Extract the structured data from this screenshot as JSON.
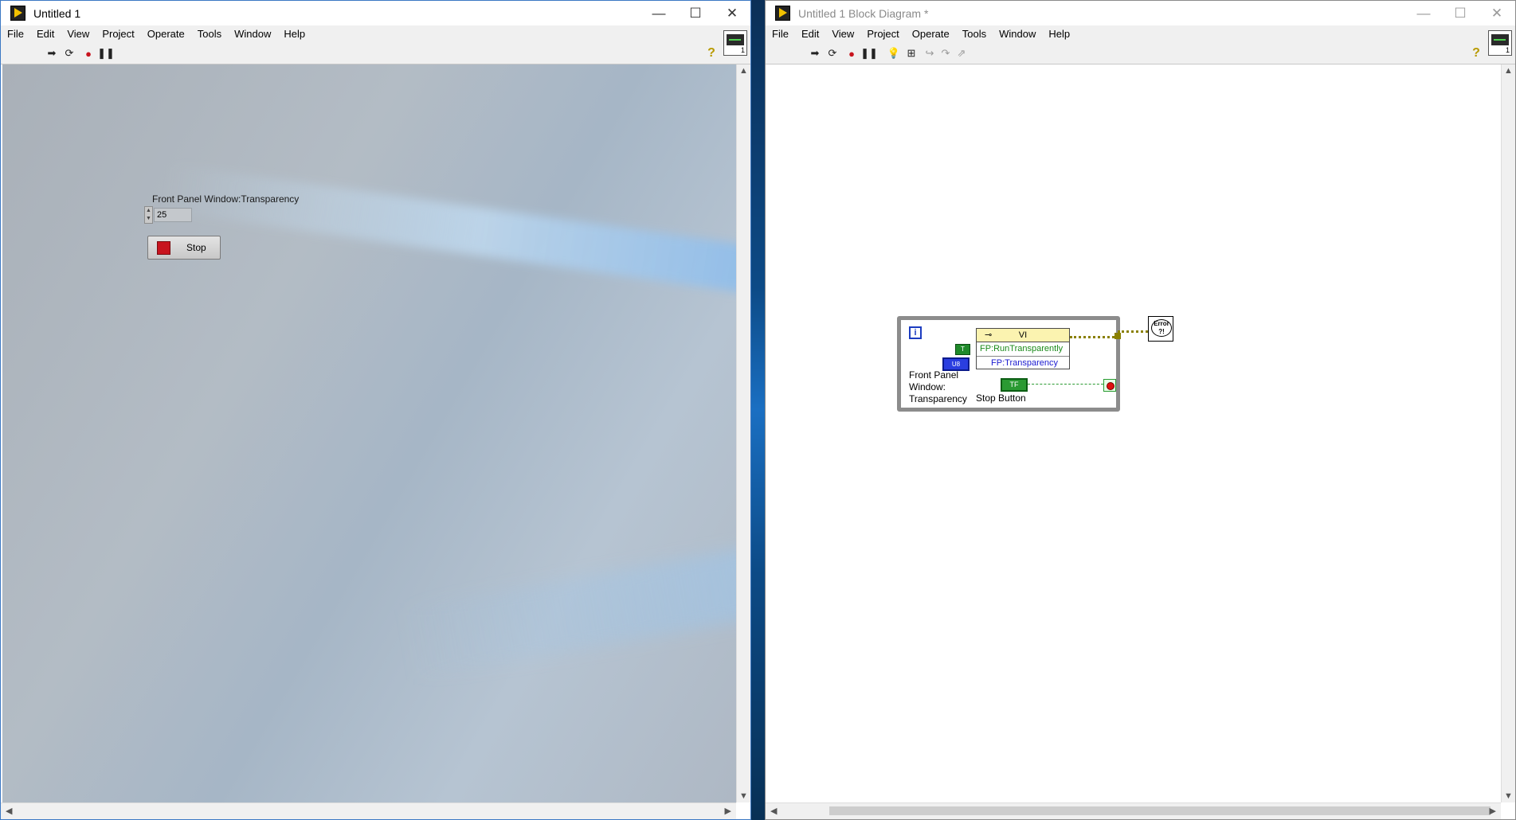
{
  "front_panel": {
    "title": "Untitled 1",
    "menu": [
      "File",
      "Edit",
      "View",
      "Project",
      "Operate",
      "Tools",
      "Window",
      "Help"
    ],
    "window_controls": {
      "minimize": "—",
      "maximize": "☐",
      "close": "✕"
    },
    "control_label": "Front Panel Window:Transparency",
    "control_value": "25",
    "stop_button_label": "Stop",
    "vi_icon_number": "1"
  },
  "block_diagram": {
    "title": "Untitled 1 Block Diagram *",
    "menu": [
      "File",
      "Edit",
      "View",
      "Project",
      "Operate",
      "Tools",
      "Window",
      "Help"
    ],
    "window_controls": {
      "minimize": "—",
      "maximize": "☐",
      "close": "✕"
    },
    "iteration_terminal": "i",
    "property_node": {
      "class": "VI",
      "properties": [
        "FP:RunTransparently",
        "FP:Transparency"
      ]
    },
    "bool_constant": "T",
    "u8_constant": "U8",
    "loop_label_lines": [
      "Front Panel",
      "Window:",
      "Transparency"
    ],
    "stop_terminal": "TF",
    "stop_terminal_label": "Stop Button",
    "error_handler_text": "Error ?!",
    "vi_icon_number": "1"
  },
  "colors": {
    "while_loop_border": "#8c8c8c",
    "bool_wire": "#2a9a32",
    "error_wire": "#8a8000",
    "u8_blue": "#2a3ee0",
    "stop_led": "#c8141e"
  }
}
